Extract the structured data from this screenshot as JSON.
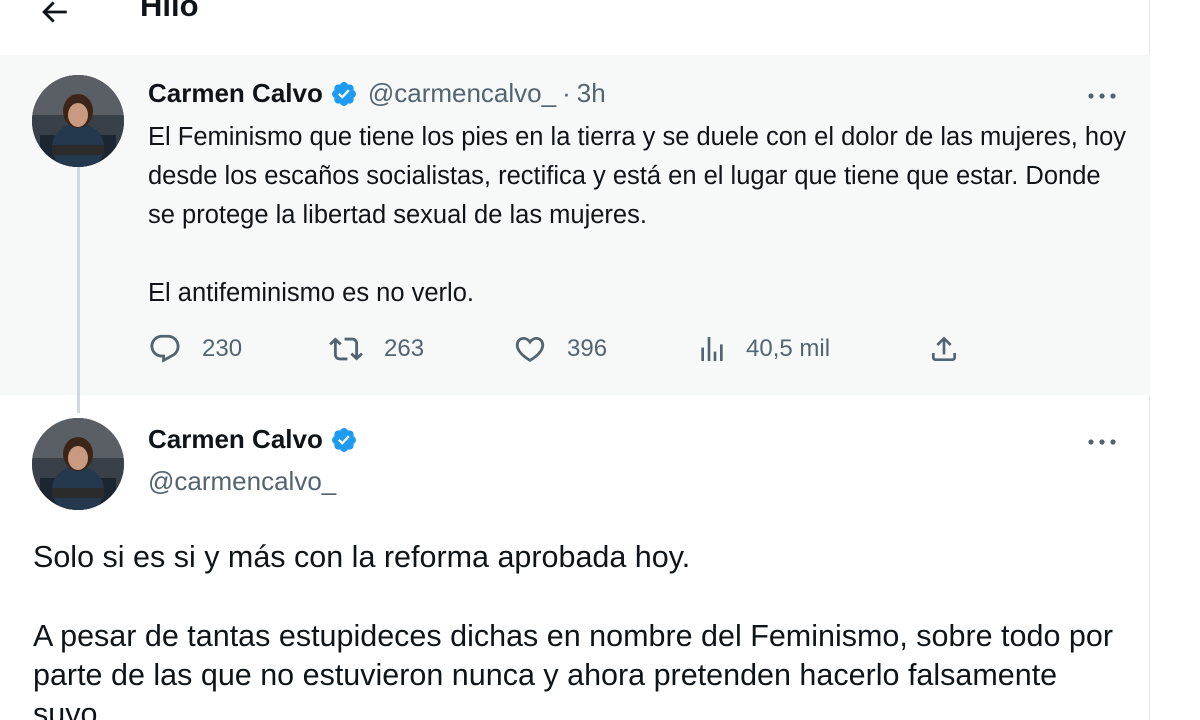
{
  "header": {
    "title": "Hilo",
    "back_icon": "arrow-left-icon"
  },
  "colors": {
    "verified": "#1d9bf0",
    "secondary_text": "#536471",
    "parent_background": "#f7f9f9",
    "thread_line": "#cfd9de"
  },
  "parent_tweet": {
    "author_name": "Carmen Calvo",
    "handle": "@carmencalvo_",
    "separator": "·",
    "time": "3h",
    "paragraphs": [
      "El Feminismo que tiene los pies en la tierra y se duele con el dolor de las mujeres, hoy desde los escaños socialistas, rectifica y está en el lugar que tiene que estar. Donde se protege la libertad sexual de las mujeres.",
      "El antifeminismo es no verlo."
    ],
    "stats": {
      "replies": "230",
      "retweets": "263",
      "likes": "396",
      "views": "40,5 mil"
    }
  },
  "main_tweet": {
    "author_name": "Carmen Calvo",
    "handle": "@carmencalvo_",
    "paragraphs": [
      "Solo si es si y más con la reforma aprobada hoy.",
      "A pesar de tantas estupideces dichas en nombre del Feminismo, sobre todo por parte de las que no estuvieron nunca y ahora pretenden hacerlo falsamente suyo."
    ]
  }
}
